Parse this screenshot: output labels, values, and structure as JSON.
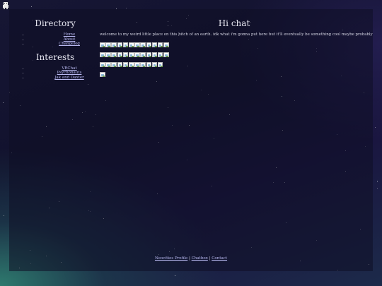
{
  "sidebar": {
    "directory_title": "Directory",
    "directory_links": [
      "Home",
      "About",
      "Changelog"
    ],
    "interests_title": "Interests",
    "interest_links": [
      "VRChat",
      "Psychonauts",
      "Jak and Daxter"
    ]
  },
  "main": {
    "title": "Hi chat",
    "welcome": "welcome to my weird little place on this bitch of an earth. idk what i'm gonna put here but it'll eventually be something cool maybe probably",
    "badge_rows": [
      12,
      12,
      11,
      1
    ]
  },
  "footer": {
    "links": [
      "Neocities Profile",
      "Chatbox",
      "Contact"
    ],
    "separator": " | "
  },
  "icons": {
    "corner": "pixel-sprite-icon",
    "badge": "broken-image-icon"
  }
}
